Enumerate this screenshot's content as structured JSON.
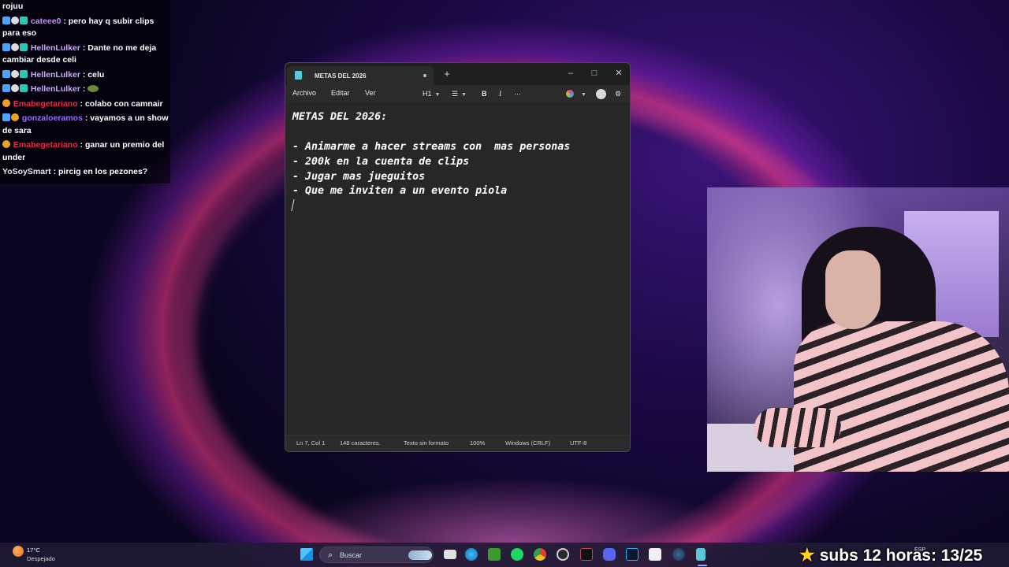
{
  "chat": {
    "messages": [
      {
        "user": "",
        "text": "rojuu",
        "user_color": "#ffffff"
      },
      {
        "user": "cateee0",
        "text": ": pero hay q subir clips para eso",
        "user_color": "#c58cff"
      },
      {
        "user": "HellenLulker",
        "text": ": Dante no me deja cambiar desde celi",
        "user_color": "#c9a8ff"
      },
      {
        "user": "HellenLulker",
        "text": ": celu",
        "user_color": "#c9a8ff"
      },
      {
        "user": "HellenLulker",
        "text": ":",
        "user_color": "#c9a8ff"
      },
      {
        "user": "Emabegetariano",
        "text": ": colabo con camnair",
        "user_color": "#e0304a"
      },
      {
        "user": "gonzaloeramos",
        "text": ": vayamos a un show de sara",
        "user_color": "#9b6bff"
      },
      {
        "user": "Emabegetariano",
        "text": ": ganar un premio del under",
        "user_color": "#e0304a"
      },
      {
        "user": "YoSoySmart",
        "text": ": pircig en los pezones?",
        "user_color": "#e8e8e8"
      }
    ]
  },
  "notepad": {
    "tab_title": "METAS DEL 2026",
    "new_tab": "+",
    "window_controls": {
      "minimize": "–",
      "maximize": "□",
      "close": "✕"
    },
    "menu": {
      "file": "Archivo",
      "edit": "Editar",
      "view": "Ver"
    },
    "toolbar": {
      "heading": "H1",
      "list": "☰",
      "bold": "B",
      "italic": "I",
      "more": "···",
      "settings": "⚙"
    },
    "lines": [
      "METAS DEL 2026:",
      "",
      "- Animarme a hacer streams con  mas personas",
      "- 200k en la cuenta de clips",
      "- Jugar mas jueguitos",
      "- Que me inviten a un evento piola"
    ],
    "status": {
      "position": "Ln 7, Col 1",
      "chars": "148 caracteres.",
      "format": "Texto sin formato",
      "zoom": "100%",
      "line_ending": "Windows (CRLF)",
      "encoding": "UTF-8"
    }
  },
  "taskbar": {
    "weather_temp": "17°C",
    "weather_desc": "Despejado",
    "search_placeholder": "Buscar",
    "lang": "ESP",
    "icons": [
      "windows-start-icon",
      "file-explorer-icon",
      "edge-icon",
      "minecraft-icon",
      "spotify-icon",
      "chrome-icon",
      "obs-icon",
      "capcut-icon",
      "discord-icon",
      "photoshop-icon",
      "capcut-alt-icon",
      "steam-icon",
      "notepad-icon"
    ]
  },
  "overlay": {
    "subgoal_text": "subs 12 horas: 13/25"
  },
  "colors": {
    "notepad_bg": "#272727",
    "accent": "#8ab4ff"
  }
}
